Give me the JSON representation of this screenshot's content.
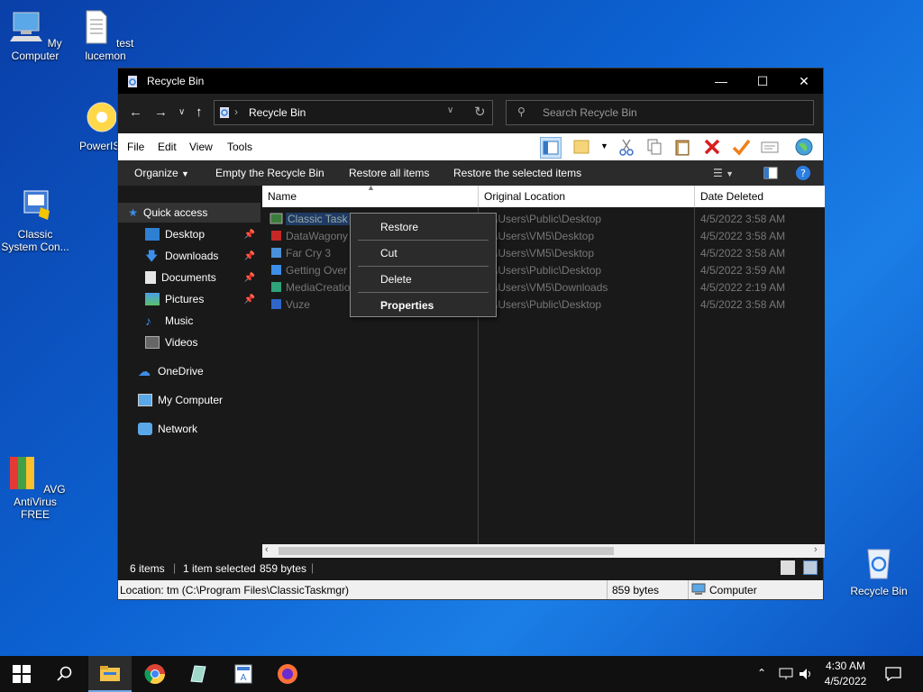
{
  "desktop": {
    "icons": [
      {
        "label": "My Computer"
      },
      {
        "label": "test lucemon"
      },
      {
        "label": "PowerIS"
      },
      {
        "label": "Classic System Con..."
      },
      {
        "label": "AVG AntiVirus FREE"
      },
      {
        "label": "Recycle Bin"
      }
    ]
  },
  "window": {
    "title": "Recycle Bin",
    "address": "Recycle Bin",
    "search_placeholder": "Search Recycle Bin",
    "menu": [
      "File",
      "Edit",
      "View",
      "Tools"
    ],
    "commands": {
      "organize": "Organize",
      "empty": "Empty the Recycle Bin",
      "restore_all": "Restore all items",
      "restore_selected": "Restore the selected items"
    },
    "nav": {
      "quick_access": "Quick access",
      "items": [
        {
          "label": "Desktop",
          "pinned": true
        },
        {
          "label": "Downloads",
          "pinned": true
        },
        {
          "label": "Documents",
          "pinned": true
        },
        {
          "label": "Pictures",
          "pinned": true
        },
        {
          "label": "Music",
          "pinned": false
        },
        {
          "label": "Videos",
          "pinned": false
        }
      ],
      "onedrive": "OneDrive",
      "mycomputer": "My Computer",
      "network": "Network"
    },
    "columns": {
      "name": "Name",
      "original": "Original Location",
      "date": "Date Deleted"
    },
    "files": [
      {
        "name": "Classic Task M",
        "loc": "C:\\Users\\Public\\Desktop",
        "date": "4/5/2022 3:58 AM"
      },
      {
        "name": "DataWagony",
        "loc": "C:\\Users\\VM5\\Desktop",
        "date": "4/5/2022 3:58 AM"
      },
      {
        "name": "Far Cry 3",
        "loc": "C:\\Users\\VM5\\Desktop",
        "date": "4/5/2022 3:58 AM"
      },
      {
        "name": "Getting Over",
        "loc": "C:\\Users\\Public\\Desktop",
        "date": "4/5/2022 3:59 AM"
      },
      {
        "name": "MediaCreatio",
        "loc": "C:\\Users\\VM5\\Downloads",
        "date": "4/5/2022 2:19 AM"
      },
      {
        "name": "Vuze",
        "loc": "C:\\Users\\Public\\Desktop",
        "date": "4/5/2022 3:58 AM"
      }
    ],
    "status": {
      "items": "6 items",
      "selected": "1 item selected",
      "size": "859 bytes"
    },
    "status2": {
      "location": "Location: tm (C:\\Program Files\\ClassicTaskmgr)",
      "size": "859 bytes",
      "zone": "Computer"
    }
  },
  "context_menu": {
    "items": [
      "Restore",
      "Cut",
      "Delete",
      "Properties"
    ]
  },
  "taskbar": {
    "time": "4:30 AM",
    "date": "4/5/2022"
  }
}
